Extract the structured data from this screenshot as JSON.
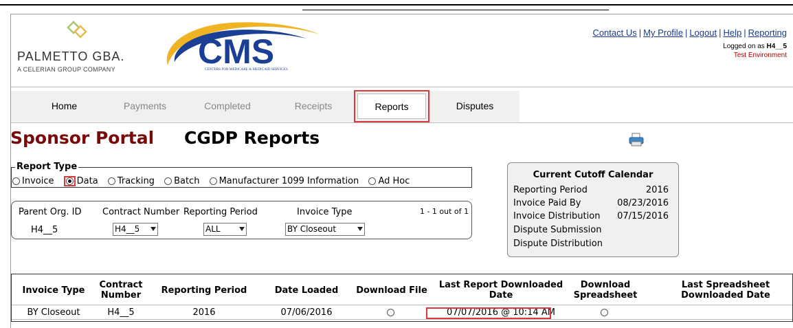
{
  "header": {
    "palmetto_name": "PALMETTO GBA.",
    "palmetto_sub": "A CELERIAN GROUP COMPANY",
    "cms_text": "CMS",
    "cms_sub": "CENTERS FOR MEDICARE & MEDICAID SERVICES",
    "links": [
      "Contact Us",
      "My Profile",
      "Logout",
      "Help",
      "Reporting"
    ],
    "logged_prefix": "Logged on as ",
    "logged_user": "H4__5",
    "environment": "Test Environment"
  },
  "nav": {
    "items": [
      "Home",
      "Payments",
      "Completed",
      "Receipts",
      "Reports",
      "Disputes"
    ],
    "active": "Reports"
  },
  "titles": {
    "portal": "Sponsor Portal",
    "page": "CGDP Reports"
  },
  "report_type": {
    "legend": "Report Type",
    "options": [
      "Invoice",
      "Data",
      "Tracking",
      "Batch",
      "Manufacturer 1099 Information",
      "Ad Hoc"
    ],
    "selected": "Data"
  },
  "filters": {
    "parent_org_label": "Parent Org. ID",
    "parent_org_value": "H4__5",
    "contract_label": "Contract Number",
    "contract_value": "H4__5",
    "period_label": "Reporting Period",
    "period_value": "ALL",
    "invoice_type_label": "Invoice Type",
    "invoice_type_value": "BY Closeout",
    "count": "1 - 1 out of 1"
  },
  "calendar": {
    "title": "Current Cutoff Calendar",
    "rows": [
      {
        "label": "Reporting Period",
        "value": "2016"
      },
      {
        "label": "Invoice Paid By",
        "value": "08/23/2016"
      },
      {
        "label": "Invoice Distribution",
        "value": "07/15/2016"
      },
      {
        "label": "Dispute Submission",
        "value": ""
      },
      {
        "label": "Dispute Distribution",
        "value": ""
      }
    ]
  },
  "table": {
    "headers": [
      "Invoice Type",
      "Contract Number",
      "Reporting Period",
      "Date Loaded",
      "Download File",
      "Last Report Downloaded Date",
      "Download Spreadsheet",
      "Last Spreadsheet Downloaded Date"
    ],
    "rows": [
      {
        "invoice_type": "BY Closeout",
        "contract": "H4__5",
        "period": "2016",
        "date_loaded": "07/06/2016",
        "last_report": "07/07/2016 @ 10:14 AM",
        "last_spreadsheet": ""
      }
    ]
  },
  "colors": {
    "portal_title": "#7a0a0a",
    "link": "#1a3a8f",
    "highlight": "#d9393f",
    "cms_blue": "#1b3f94",
    "cms_gold": "#f0b323",
    "palmetto_green": "#a8c66c",
    "palmetto_gold": "#e8b84a"
  }
}
